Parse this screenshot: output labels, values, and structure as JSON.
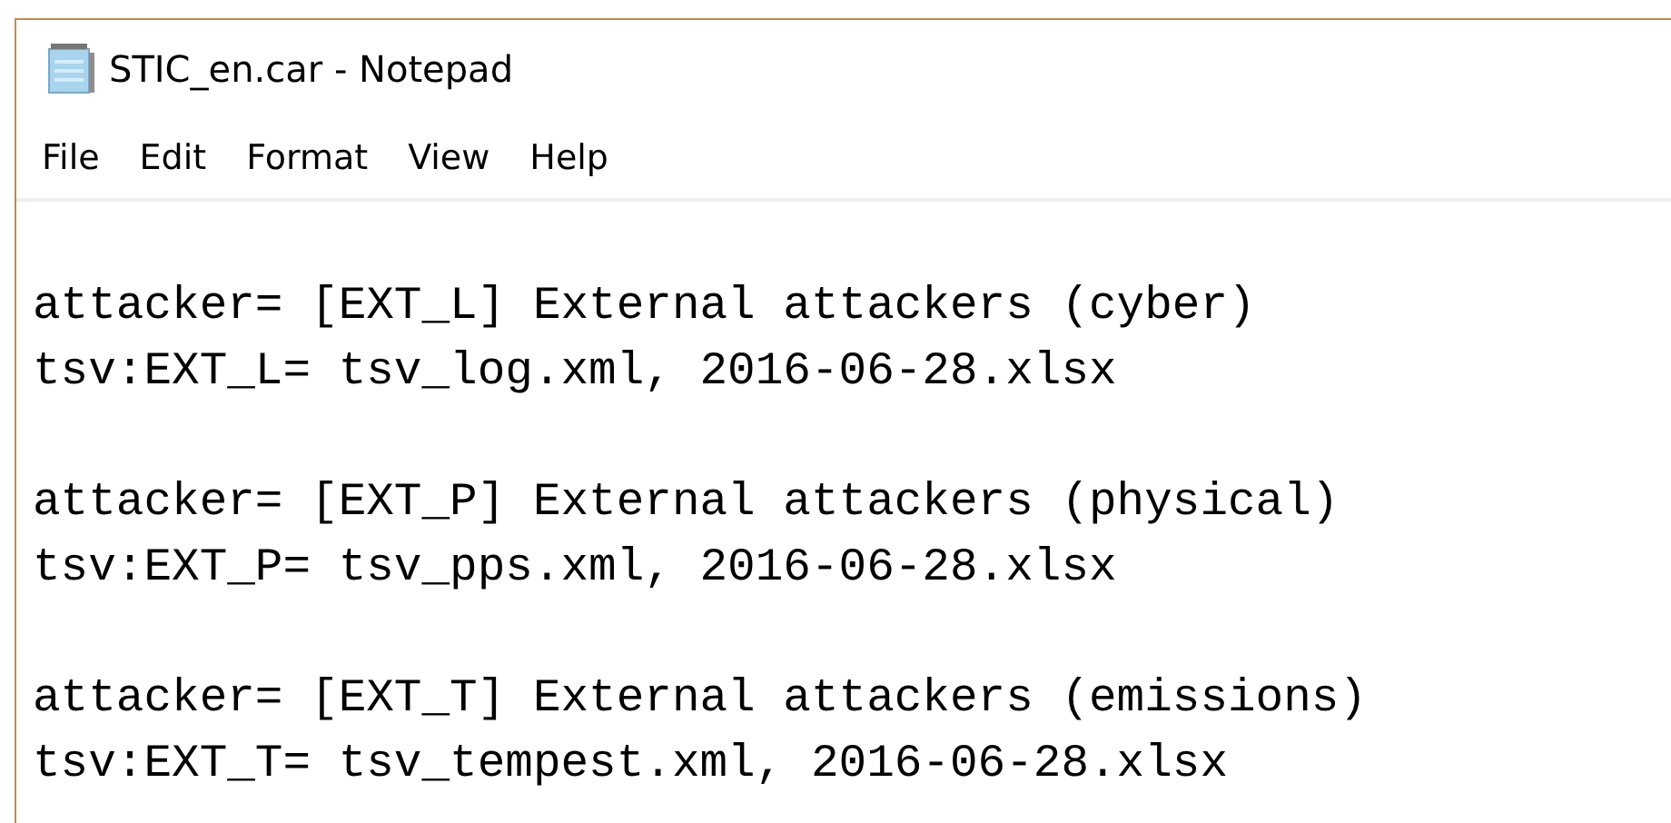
{
  "window": {
    "title": "STIC_en.car - Notepad"
  },
  "menu": [
    "File",
    "Edit",
    "Format",
    "View",
    "Help"
  ],
  "editor": {
    "blocks": [
      [
        "attacker= [EXT_L] External attackers (cyber)",
        "tsv:EXT_L= tsv_log.xml, 2016-06-28.xlsx"
      ],
      [
        "attacker= [EXT_P] External attackers (physical)",
        "tsv:EXT_P= tsv_pps.xml, 2016-06-28.xlsx"
      ],
      [
        "attacker= [EXT_T] External attackers (emissions)",
        "tsv:EXT_T= tsv_tempest.xml, 2016-06-28.xlsx"
      ]
    ]
  }
}
